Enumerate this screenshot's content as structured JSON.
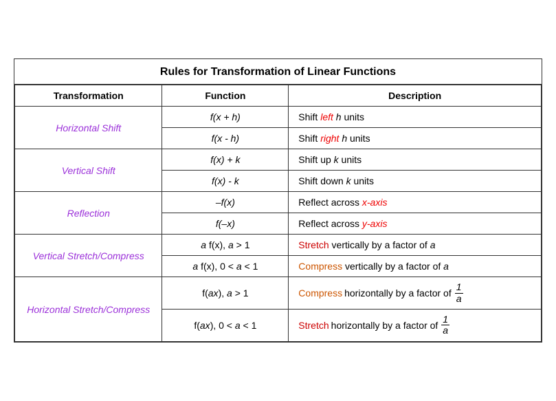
{
  "title": "Rules for Transformation of Linear Functions",
  "headers": {
    "transformation": "Transformation",
    "function": "Function",
    "description": "Description"
  },
  "rows": [
    {
      "transform": "Horizontal Shift",
      "sub": [
        {
          "function": "f(x + h)",
          "desc_parts": [
            "Shift ",
            "left",
            " ",
            "h",
            " units"
          ]
        },
        {
          "function": "f(x  - h)",
          "desc_parts": [
            "Shift ",
            "right",
            " ",
            "h",
            " units"
          ]
        }
      ]
    },
    {
      "transform": "Vertical Shift",
      "sub": [
        {
          "function": "f(x) + k",
          "desc_parts": [
            "Shift up ",
            "k",
            " units"
          ]
        },
        {
          "function": "f(x) - k",
          "desc_parts": [
            "Shift down ",
            "k",
            " units"
          ]
        }
      ]
    },
    {
      "transform": "Reflection",
      "sub": [
        {
          "function": "–f(x)",
          "desc_parts": [
            "Reflect across ",
            "x-axis"
          ]
        },
        {
          "function": "f(–x)",
          "desc_parts": [
            "Reflect across ",
            "y-axis"
          ]
        }
      ]
    },
    {
      "transform": "Vertical Stretch/Compress",
      "sub": [
        {
          "function": "a f(x), a > 1",
          "desc_parts": [
            "Stretch",
            " vertically by a factor of ",
            "a"
          ]
        },
        {
          "function": "a f(x), 0 < a < 1",
          "desc_parts": [
            "Compress",
            " vertically by a factor of ",
            "a"
          ]
        }
      ]
    },
    {
      "transform": "Horizontal Stretch/Compress",
      "sub": [
        {
          "function": "f(ax), a > 1",
          "desc_parts": [
            "Compress",
            " horizontally by a factor of ",
            "fraction"
          ]
        },
        {
          "function": "f(ax), 0 < a < 1",
          "desc_parts": [
            "Stretch",
            " horizontally by a factor of ",
            "fraction"
          ]
        }
      ]
    }
  ]
}
